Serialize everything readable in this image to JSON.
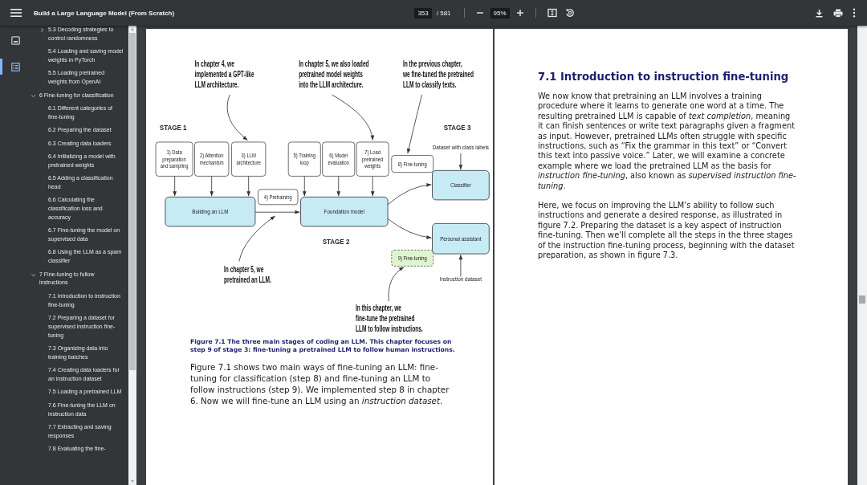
{
  "toolbar": {
    "title": "Build a Large Language Model (From Scratch)",
    "page_number": "353",
    "page_total": "/ 581",
    "zoom": "95%"
  },
  "rail": [
    {
      "kind": "thumbnails",
      "selected": false
    },
    {
      "kind": "outline",
      "selected": true
    }
  ],
  "outline": [
    {
      "kind": "continued",
      "children": [
        {
          "label": "5.3 Decoding strategies to control randomness",
          "expanded": false
        },
        {
          "label": "5.4 Loading and saving model weights in PyTorch"
        },
        {
          "label": "5.5 Loading pretrained weights from OpenAI"
        }
      ]
    },
    {
      "kind": "chapter",
      "label": "6 Fine-tuning for classification",
      "expanded": true,
      "children": [
        {
          "label": "6.1 Different categories of fine-tuning"
        },
        {
          "label": "6.2 Preparing the dataset"
        },
        {
          "label": "6.3 Creating data loaders"
        },
        {
          "label": "6.4 Initializing a model with pretrained weights"
        },
        {
          "label": "6.5 Adding a classification head"
        },
        {
          "label": "6.6 Calculating the classification loss and accuracy"
        },
        {
          "label": "6.7 Fine-tuning the model on supervised data"
        },
        {
          "label": "6.8 Using the LLM as a spam classifier"
        }
      ]
    },
    {
      "kind": "chapter",
      "label": "7 Fine-tuning to follow instructions",
      "expanded": true,
      "children": [
        {
          "label": "7.1 Introduction to instruction fine-tuning"
        },
        {
          "label": "7.2 Preparing a dataset for supervised instruction fine-tuning"
        },
        {
          "label": "7.3 Organizing data into training batches"
        },
        {
          "label": "7.4 Creating data loaders for an instruction dataset"
        },
        {
          "label": "7.5 Loading a pretrained LLM"
        },
        {
          "label": "7.6 Fine-tuning the LLM on instruction data"
        },
        {
          "label": "7.7 Extracting and saving responses"
        },
        {
          "label": "7.8 Evaluating the fine-"
        }
      ]
    }
  ],
  "left_page": {
    "figure": {
      "callouts": [
        {
          "lines": [
            "In chapter 4, we",
            "implemented a GPT-like",
            "LLM architecture."
          ]
        },
        {
          "lines": [
            "In chapter 5, we also loaded",
            "pretrained model weights",
            "into the LLM architecture."
          ]
        },
        {
          "lines": [
            "In the previous chapter,",
            "we fine-tuned the pretrained",
            "LLM to classify texts."
          ]
        },
        {
          "lines": [
            "In chapter 5, we",
            "pretrained an LLM."
          ]
        },
        {
          "lines": [
            "In this chapter, we",
            "fine-tune the pretrained",
            "LLM to follow instructions."
          ]
        }
      ],
      "stages": [
        {
          "label": "STAGE 1"
        },
        {
          "label": "STAGE 2"
        },
        {
          "label": "STAGE 3"
        }
      ],
      "steps": [
        {
          "kind": "step",
          "lines": [
            "1) Data",
            "preparation",
            "and sampling"
          ]
        },
        {
          "kind": "step",
          "lines": [
            "2) Attention",
            "mechanism"
          ]
        },
        {
          "kind": "step",
          "lines": [
            "3) LLM",
            "architecture"
          ]
        },
        {
          "kind": "step",
          "lines": [
            "4) Pretraining"
          ]
        },
        {
          "kind": "step",
          "lines": [
            "5) Training",
            "loop"
          ]
        },
        {
          "kind": "step",
          "lines": [
            "6) Model",
            "evaluation"
          ]
        },
        {
          "kind": "step",
          "lines": [
            "7) Load",
            "pretrained",
            "weights"
          ]
        },
        {
          "kind": "step",
          "lines": [
            "8) Fine-tuning"
          ]
        },
        {
          "kind": "highlight",
          "lines": [
            "9) Fine-tuning"
          ]
        }
      ],
      "blocks": [
        {
          "label": "Building an LLM"
        },
        {
          "label": "Foundation model"
        },
        {
          "label": "Classifier"
        },
        {
          "label": "Personal assistant"
        }
      ],
      "inputs": [
        {
          "label": "Dataset with class labels"
        },
        {
          "label": "Instruction dataset"
        }
      ]
    },
    "caption": "Figure 7.1 The three main stages of coding an LLM. This chapter focuses on step 9 of stage 3: fine-tuning a pretrained LLM to follow human instructions.",
    "paragraphs": [
      "Figure 7.1 shows two main ways of fine-tuning an LLM: fine-tuning for classification (step 8) and fine-tuning an LLM to follow instructions (step 9). We implemented step 8 in chapter 6. Now we will fine-tune an LLM using an *instruction dataset*."
    ]
  },
  "right_page": {
    "heading": "7.1 Introduction to instruction fine-tuning",
    "paragraphs": [
      "We now know that pretraining an LLM involves a training procedure where it learns to generate one word at a time. The resulting pretrained LLM is capable of *text completion*, meaning it can finish sentences or write text paragraphs given a fragment as input. However, pretrained LLMs often struggle with specific instructions, such as “Fix the grammar in this text” or “Convert this text into passive voice.” Later, we will examine a concrete example where we load the pretrained LLM as the basis for *instruction fine-tuning*, also known as *supervised instruction fine-tuning*.",
      "Here, we focus on improving the LLM’s ability to follow such instructions and generate a desired response, as illustrated in figure 7.2. Preparing the dataset is a key aspect of instruction fine-tuning. Then we’ll complete all the steps in the three stages of the instruction fine-tuning process, beginning with the dataset preparation, as shown in figure 7.3."
    ]
  }
}
